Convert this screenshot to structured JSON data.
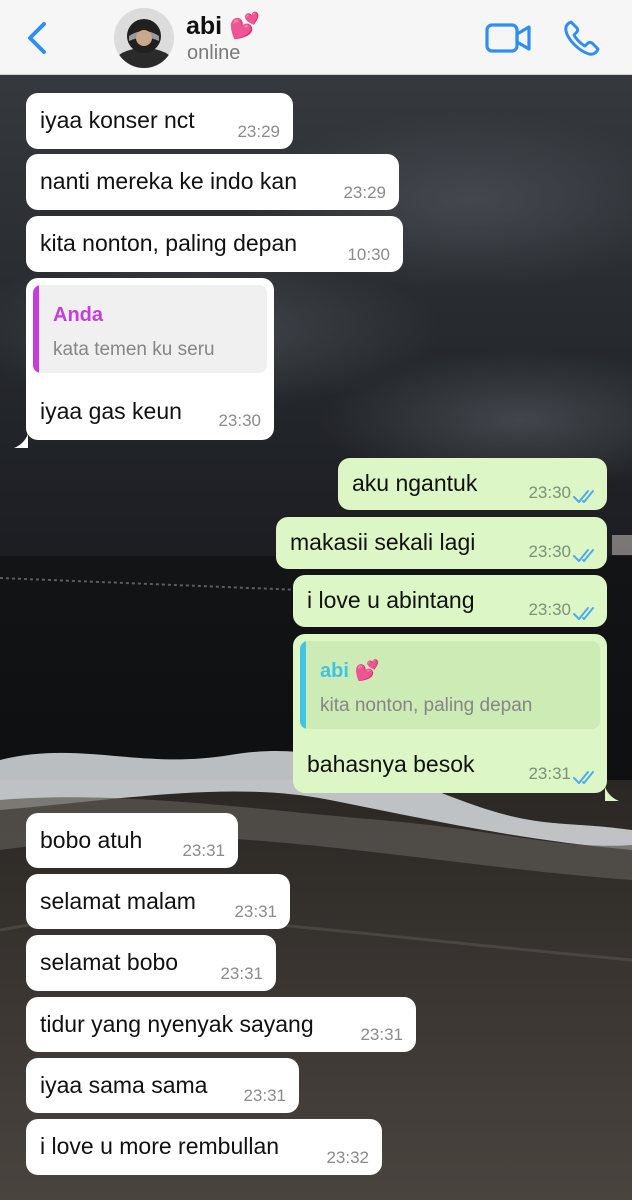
{
  "header": {
    "contact_name": "abi 💕",
    "status": "online"
  },
  "colors": {
    "accent": "#2f8ef4",
    "incoming_bubble": "#ffffff",
    "outgoing_bubble": "#dcf7c5",
    "read_ticks": "#4fa9f0",
    "quote_author_incoming": "#c63dd9",
    "quote_bar_incoming": "#c63dd9",
    "quote_author_outgoing": "#3fc4e3",
    "quote_bar_outgoing": "#3fc4e3"
  },
  "icons": [
    "back-chevron-icon",
    "video-call-icon",
    "phone-icon",
    "double-check-icon"
  ],
  "messages": [
    {
      "dir": "in",
      "text": "iyaa konser nct",
      "time": "23:29"
    },
    {
      "dir": "in",
      "text": "nanti mereka ke indo kan",
      "time": "23:29"
    },
    {
      "dir": "in",
      "text": "kita nonton, paling depan",
      "time": "10:30"
    },
    {
      "dir": "in",
      "text": "iyaa gas keun",
      "time": "23:30",
      "quote": {
        "author": "Anda",
        "text": "kata temen ku seru"
      }
    },
    {
      "dir": "out",
      "text": "aku ngantuk",
      "time": "23:30",
      "read": true
    },
    {
      "dir": "out",
      "text": "makasii sekali lagi",
      "time": "23:30",
      "read": true
    },
    {
      "dir": "out",
      "text": "i love u abintang",
      "time": "23:30",
      "read": true
    },
    {
      "dir": "out",
      "text": "bahasnya besok",
      "time": "23:31",
      "read": true,
      "quote": {
        "author": "abi 💕",
        "text": "kita nonton, paling depan"
      }
    },
    {
      "dir": "in",
      "text": "bobo atuh",
      "time": "23:31"
    },
    {
      "dir": "in",
      "text": "selamat malam",
      "time": "23:31"
    },
    {
      "dir": "in",
      "text": "selamat bobo",
      "time": "23:31"
    },
    {
      "dir": "in",
      "text": "tidur yang nyenyak sayang",
      "time": "23:31"
    },
    {
      "dir": "in",
      "text": "iyaa sama sama",
      "time": "23:31"
    },
    {
      "dir": "in",
      "text": "i love u more rembullan",
      "time": "23:32"
    }
  ]
}
